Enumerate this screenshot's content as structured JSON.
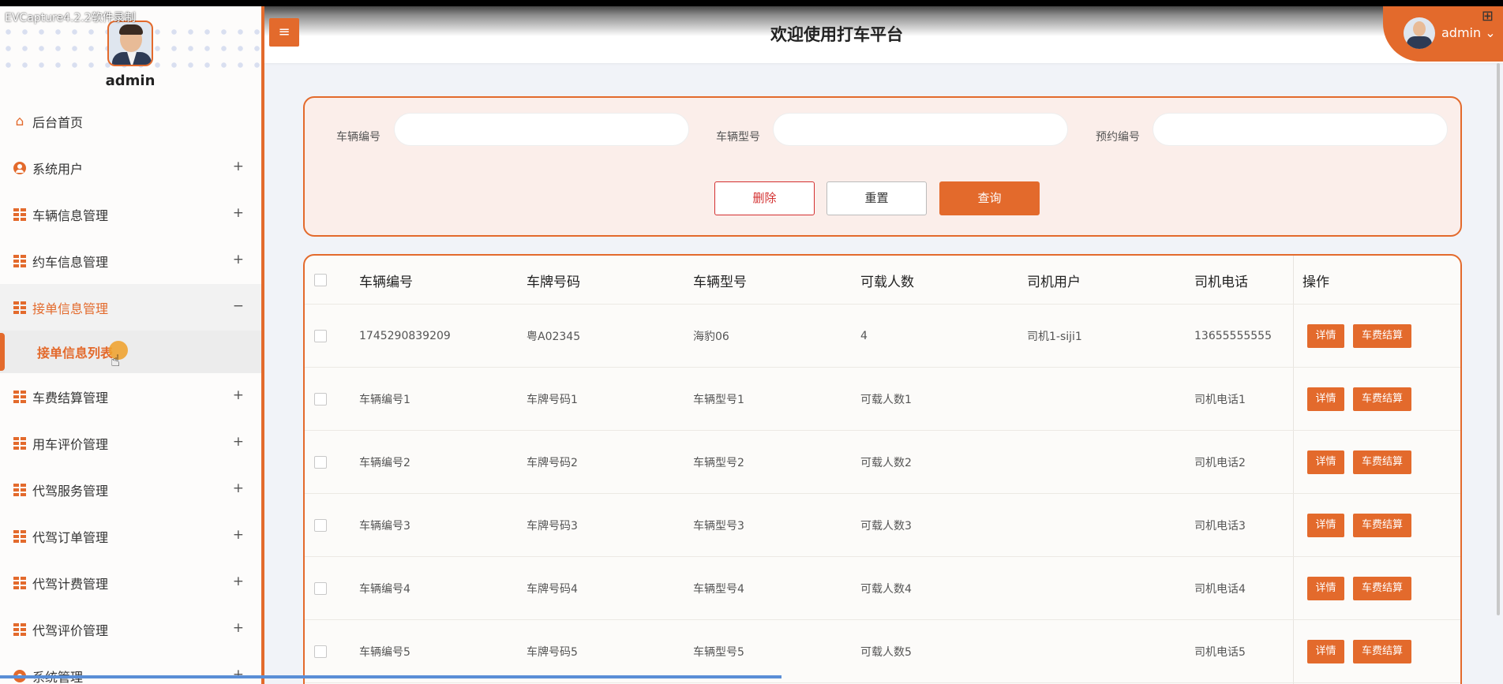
{
  "capture_title": "EVCapture4.2.2软件录制",
  "header": {
    "title": "欢迎使用打车平台",
    "menu_glyph": "≡",
    "user_name": "admin",
    "user_caret": "⌄"
  },
  "sidebar": {
    "user_name": "admin",
    "items": [
      {
        "label": "后台首页",
        "icon": "home-icon",
        "toggle": ""
      },
      {
        "label": "系统用户",
        "icon": "user-icon",
        "toggle": "+"
      },
      {
        "label": "车辆信息管理",
        "icon": "grid-icon",
        "toggle": "+"
      },
      {
        "label": "约车信息管理",
        "icon": "grid-icon",
        "toggle": "+"
      },
      {
        "label": "接单信息管理",
        "icon": "grid-icon",
        "toggle": "−"
      },
      {
        "label": "车费结算管理",
        "icon": "grid-icon",
        "toggle": "+"
      },
      {
        "label": "用车评价管理",
        "icon": "grid-icon",
        "toggle": "+"
      },
      {
        "label": "代驾服务管理",
        "icon": "grid-icon",
        "toggle": "+"
      },
      {
        "label": "代驾订单管理",
        "icon": "grid-icon",
        "toggle": "+"
      },
      {
        "label": "代驾计费管理",
        "icon": "grid-icon",
        "toggle": "+"
      },
      {
        "label": "代驾评价管理",
        "icon": "grid-icon",
        "toggle": "+"
      },
      {
        "label": "系统管理",
        "icon": "gear-icon",
        "toggle": "+"
      }
    ],
    "subitem": "接单信息列表"
  },
  "search": {
    "fields": [
      {
        "label": "车辆编号",
        "value": "",
        "placeholder": ""
      },
      {
        "label": "车辆型号",
        "value": "",
        "placeholder": ""
      },
      {
        "label": "预约编号",
        "value": "",
        "placeholder": ""
      }
    ],
    "delete_label": "删除",
    "reset_label": "重置",
    "query_label": "查询"
  },
  "table": {
    "columns": [
      "车辆编号",
      "车牌号码",
      "车辆型号",
      "可载人数",
      "司机用户",
      "司机电话",
      "操作"
    ],
    "detail_label": "详情",
    "settle_label": "车费结算",
    "rows": [
      [
        "1745290839209",
        "粤A02345",
        "海豹06",
        "4",
        "司机1-siji1",
        "13655555555"
      ],
      [
        "车辆编号1",
        "车牌号码1",
        "车辆型号1",
        "可载人数1",
        "",
        "司机电话1"
      ],
      [
        "车辆编号2",
        "车牌号码2",
        "车辆型号2",
        "可载人数2",
        "",
        "司机电话2"
      ],
      [
        "车辆编号3",
        "车牌号码3",
        "车辆型号3",
        "可载人数3",
        "",
        "司机电话3"
      ],
      [
        "车辆编号4",
        "车牌号码4",
        "车辆型号4",
        "可载人数4",
        "",
        "司机电话4"
      ],
      [
        "车辆编号5",
        "车牌号码5",
        "车辆型号5",
        "可载人数5",
        "",
        "司机电话5"
      ]
    ]
  },
  "colors": {
    "accent": "#e36a2c",
    "delete": "#d32f2f"
  }
}
